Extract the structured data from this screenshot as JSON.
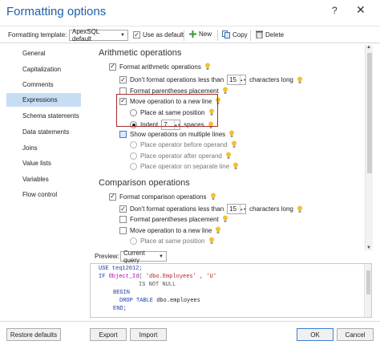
{
  "window": {
    "title": "Formatting options",
    "help": "?",
    "close": "✕"
  },
  "toolbar": {
    "template_label": "Formatting template:",
    "template_value": "ApexSQL default",
    "use_default_label": "Use as default",
    "new_label": "New",
    "copy_label": "Copy",
    "delete_label": "Delete"
  },
  "nav": {
    "items": [
      "General",
      "Capitalization",
      "Comments",
      "Expressions",
      "Schema statements",
      "Data statements",
      "Joins",
      "Value lists",
      "Variables",
      "Flow control"
    ],
    "active": "Expressions"
  },
  "arith": {
    "title": "Arithmetic operations",
    "format_ops": "Format arithmetic operations",
    "dont_format": "Don't format operations less than",
    "dont_format_value": "15",
    "chars_long": "characters long",
    "parens": "Format parentheses placement",
    "move_new_line": "Move operation to a new line",
    "place_same": "Place at same position",
    "indent": "Indent",
    "indent_value": "7",
    "spaces": "spaces",
    "show_multiple": "Show operations on multiple lines",
    "before_operand": "Place operator before operand",
    "after_operand": "Place operator after operand",
    "separate_line": "Place operator on separate line"
  },
  "comp": {
    "title": "Comparison operations",
    "format_ops": "Format comparison operations",
    "dont_format": "Don't format operations less than",
    "dont_format_value": "15",
    "chars_long": "characters long",
    "parens": "Format parentheses placement",
    "move_new_line": "Move operation to a new line",
    "place_same": "Place at same position"
  },
  "preview": {
    "label": "Preview:",
    "select": "Current query",
    "code": {
      "l1": "USE teq12012;",
      "l2a": "IF ",
      "l2b": "Object_Id",
      "l2c": "( ",
      "l2d": "'dbo.Employees'",
      "l2e": " , ",
      "l2f": "'U'",
      "l3": "IS NOT NULL",
      "l4": "BEGIN",
      "l5a": "DROP TABLE ",
      "l5b": "dbo.employees",
      "l6": "END;"
    }
  },
  "buttons": {
    "restore": "Restore defaults",
    "export": "Export",
    "import": "Import",
    "ok": "OK",
    "cancel": "Cancel"
  },
  "colors": {
    "accent": "#1f5fa8",
    "highlight_box": "#a62b2b",
    "nav_active": "#c7ddf4",
    "bulb": "#f2c230"
  }
}
